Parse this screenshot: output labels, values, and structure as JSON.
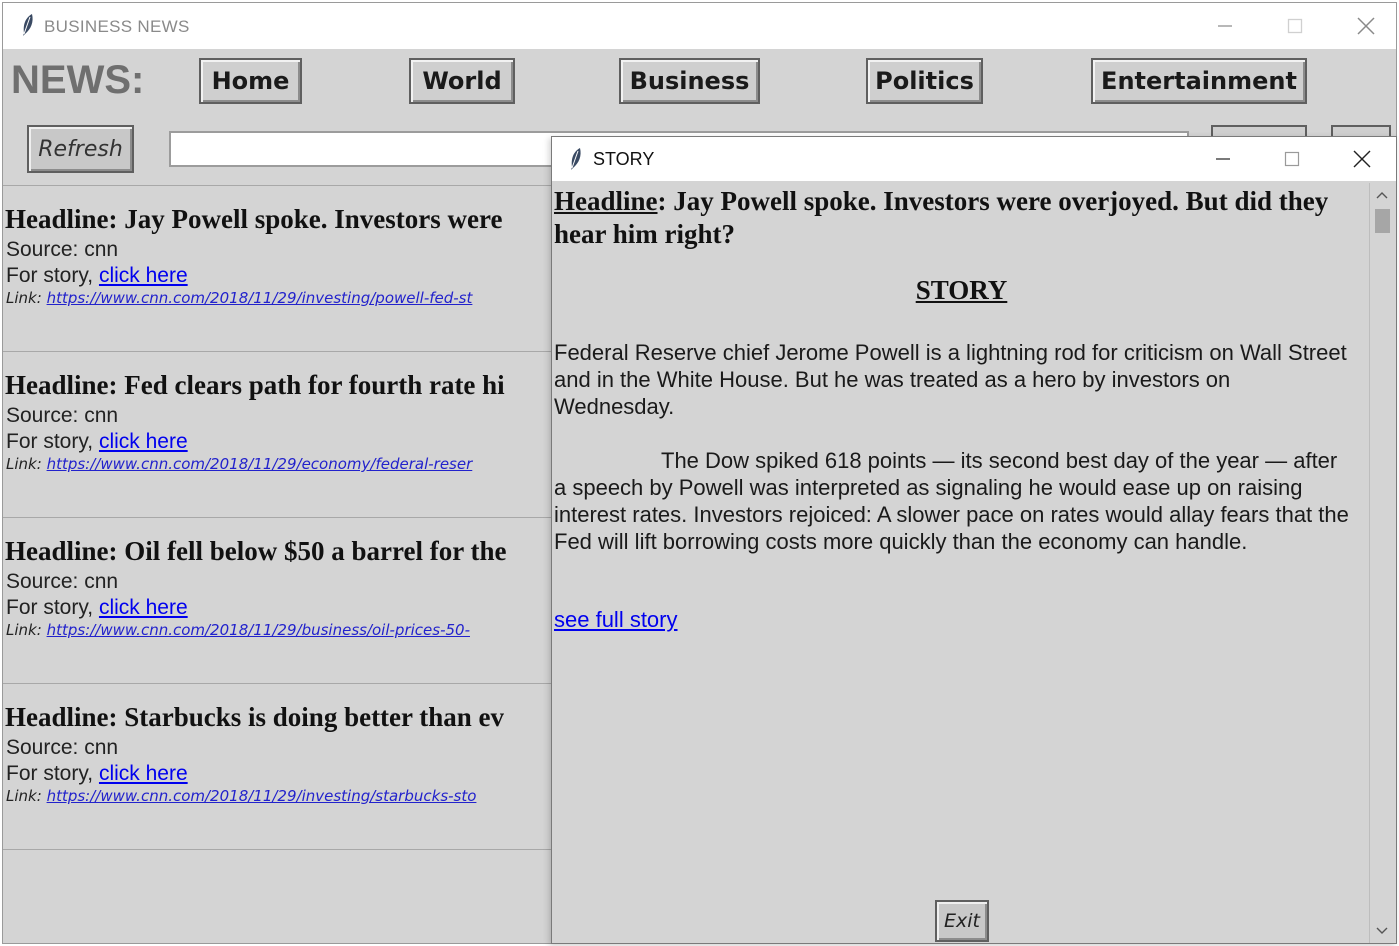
{
  "main_window": {
    "title": "BUSINESS NEWS",
    "news_label": "NEWS:",
    "nav": [
      "Home",
      "World",
      "Business",
      "Politics",
      "Entertainment"
    ],
    "refresh_label": "Refresh",
    "search_value": ""
  },
  "articles": [
    {
      "headline": "Headline: Jay Powell spoke. Investors were",
      "source": "Source:  cnn",
      "story_prefix": "For story, ",
      "story_link": "click here",
      "link_label": "Link:",
      "link_url": " https://www.cnn.com/2018/11/29/investing/powell-fed-st"
    },
    {
      "headline": "Headline: Fed clears path for fourth rate hi",
      "source": "Source:  cnn",
      "story_prefix": "For story, ",
      "story_link": "click here",
      "link_label": "Link:",
      "link_url": " https://www.cnn.com/2018/11/29/economy/federal-reser"
    },
    {
      "headline": "Headline: Oil fell below $50 a barrel for the",
      "source": "Source:  cnn",
      "story_prefix": "For story, ",
      "story_link": "click here",
      "link_label": "Link:",
      "link_url": " https://www.cnn.com/2018/11/29/business/oil-prices-50-"
    },
    {
      "headline": "Headline: Starbucks is doing better than ev",
      "source": "Source:  cnn",
      "story_prefix": "For story, ",
      "story_link": "click here",
      "link_label": "Link:",
      "link_url": " https://www.cnn.com/2018/11/29/investing/starbucks-sto"
    }
  ],
  "story_window": {
    "title": "STORY",
    "headline_label": "Headline",
    "headline_text": ":  Jay Powell spoke. Investors were overjoyed. But did they hear him right?",
    "story_title": "STORY",
    "paragraph1": "Federal Reserve chief Jerome Powell is a lightning rod for criticism on Wall Street and in the White House. But he was treated as a hero by investors on Wednesday.",
    "paragraph2": "The Dow spiked 618 points — its second best day of the year — after a speech by Powell was interpreted as signaling he would ease up on raising interest rates. Investors rejoiced: A slower pace on rates would allay fears that the Fed will lift borrowing costs more quickly than the economy can handle.",
    "full_story_link": "see full story",
    "exit_label": "Exit"
  },
  "icons": {
    "app": "feather-icon",
    "minimize": "minimize-icon",
    "maximize": "maximize-icon",
    "close": "close-icon",
    "scroll_up": "chevron-up-icon",
    "scroll_down": "chevron-down-icon"
  },
  "colors": {
    "window_bg": "#d4d4d4",
    "link": "#0000ee"
  }
}
